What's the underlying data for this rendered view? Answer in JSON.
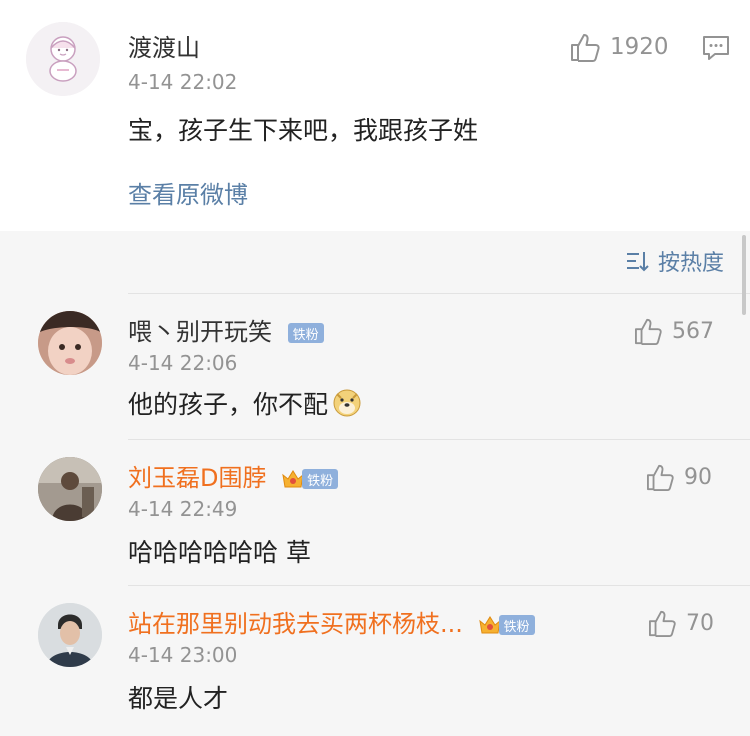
{
  "post": {
    "username": "渡渡山",
    "time": "4-14 22:02",
    "content": "宝，孩子生下来吧，我跟孩子姓",
    "likes": "1920",
    "view_original": "查看原微博",
    "avatar_icon": "cartoon-baby-avatar"
  },
  "sort": {
    "label": "按热度",
    "icon": "sort-icon"
  },
  "comments": [
    {
      "username": "喂丶别开玩笑",
      "badge": "铁粉",
      "time": "4-14 22:06",
      "content": "他的孩子，你不配",
      "emoji": "doge",
      "likes": "567",
      "name_color": "#333333"
    },
    {
      "username": "刘玉磊D围脖",
      "badge": "铁粉",
      "time": "4-14 22:49",
      "content": "哈哈哈哈哈哈 草",
      "likes": "90",
      "name_color": "#f0701f"
    },
    {
      "username": "站在那里别动我去买两杯杨枝...",
      "badge": "铁粉",
      "time": "4-14 23:00",
      "content": "都是人才",
      "likes": "70",
      "name_color": "#f0701f"
    }
  ],
  "colors": {
    "link_blue": "#5a7fa6",
    "vip_orange": "#f0701f",
    "badge_blue": "#8fb0dc"
  }
}
